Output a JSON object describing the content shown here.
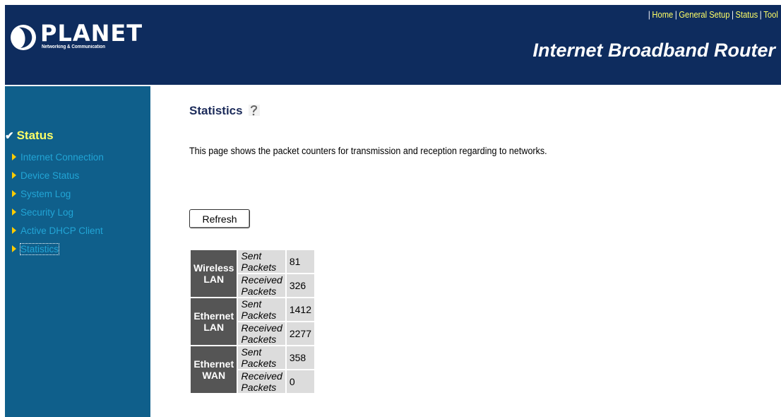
{
  "header": {
    "brand": "PLANET",
    "brand_sub": "Networking & Communication",
    "title": "Internet Broadband Router",
    "nav": [
      "Home",
      "General Setup",
      "Status",
      "Tool"
    ]
  },
  "sidebar": {
    "heading": "Status",
    "items": [
      {
        "label": "Internet Connection"
      },
      {
        "label": "Device Status"
      },
      {
        "label": "System Log"
      },
      {
        "label": "Security Log"
      },
      {
        "label": "Active DHCP Client"
      },
      {
        "label": "Statistics"
      }
    ]
  },
  "main": {
    "title": "Statistics",
    "description": "This page shows the packet counters for transmission and reception regarding to networks.",
    "refresh_label": "Refresh",
    "stats": [
      {
        "name": "Wireless LAN",
        "sent_label": "Sent Packets",
        "sent": "81",
        "received_label": "Received Packets",
        "received": "326"
      },
      {
        "name": "Ethernet LAN",
        "sent_label": "Sent Packets",
        "sent": "1412",
        "received_label": "Received Packets",
        "received": "2277"
      },
      {
        "name": "Ethernet WAN",
        "sent_label": "Sent Packets",
        "sent": "358",
        "received_label": "Received Packets",
        "received": "0"
      }
    ]
  },
  "colors": {
    "header_bg": "#0e2c5e",
    "sidebar_bg": "#0f5f8b",
    "nav_link": "#ffff66",
    "group_cell": "#555555",
    "data_cell": "#dcdcdc"
  }
}
